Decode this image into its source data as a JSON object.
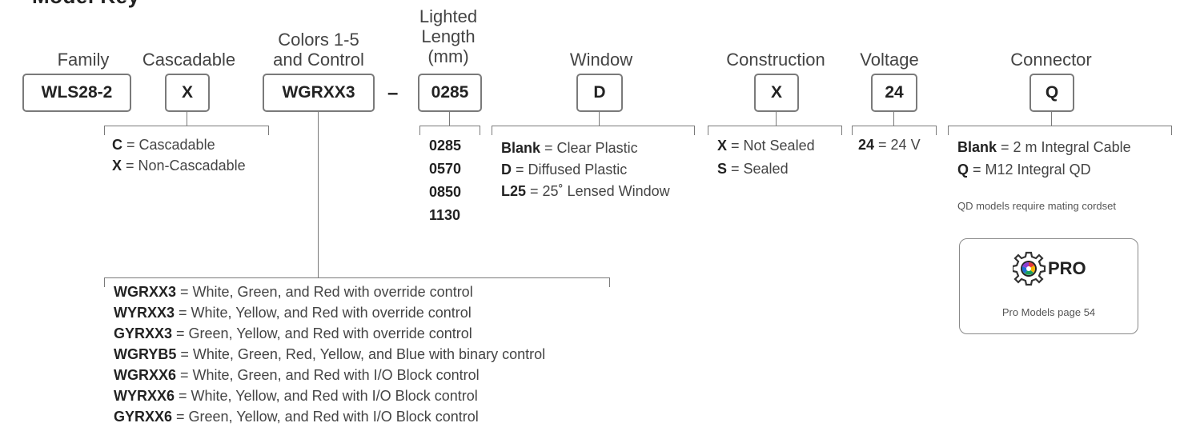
{
  "page_title": "Model Key",
  "headers": {
    "family": "Family",
    "cascadable": "Cascadable",
    "colors": [
      "Colors 1-5",
      "and Control"
    ],
    "length": [
      "Lighted",
      "Length",
      "(mm)"
    ],
    "window": "Window",
    "construction": "Construction",
    "voltage": "Voltage",
    "connector": "Connector"
  },
  "boxes": {
    "family": "WLS28-2",
    "cascadable": "X",
    "colors": "WGRXX3",
    "separator": "–",
    "length": "0285",
    "window": "D",
    "construction": "X",
    "voltage": "24",
    "connector": "Q"
  },
  "cascadable_options": [
    {
      "code": "C",
      "desc": " = Cascadable"
    },
    {
      "code": "X",
      "desc": " = Non-Cascadable"
    }
  ],
  "length_options": [
    "0285",
    "0570",
    "0850",
    "1130"
  ],
  "window_options": [
    {
      "code": "Blank",
      "desc": " = Clear Plastic"
    },
    {
      "code": "D",
      "desc": " = Diffused Plastic"
    },
    {
      "code": "L25",
      "desc": " = 25˚ Lensed Window"
    }
  ],
  "construction_options": [
    {
      "code": "X",
      "desc": " = Not Sealed"
    },
    {
      "code": "S",
      "desc": " = Sealed"
    }
  ],
  "voltage_options": [
    {
      "code": "24",
      "desc": " = 24 V"
    }
  ],
  "connector_options": [
    {
      "code": "Blank",
      "desc": " = 2 m Integral Cable"
    },
    {
      "code": "Q",
      "desc": " = M12 Integral QD"
    }
  ],
  "connector_note": "QD models require mating cordset",
  "pro": {
    "logo_text": "PRO",
    "caption": "Pro Models page 54"
  },
  "color_options": [
    {
      "code": "WGRXX3",
      "desc": " = White, Green, and Red with override control"
    },
    {
      "code": "WYRXX3",
      "desc": " = White, Yellow, and Red with override control"
    },
    {
      "code": "GYRXX3",
      "desc": " = Green, Yellow, and Red with override control"
    },
    {
      "code": "WGRYB5",
      "desc": " = White, Green, Red, Yellow, and Blue with binary control"
    },
    {
      "code": "WGRXX6",
      "desc": " = White, Green, and Red with I/O Block control"
    },
    {
      "code": "WYRXX6",
      "desc": " = White, Yellow, and Red with I/O Block control"
    },
    {
      "code": "GYRXX6",
      "desc": " = Green, Yellow, and Red with I/O Block control"
    }
  ],
  "colors": {
    "line": "#7a7a7a",
    "text": "#2a2a2a"
  }
}
